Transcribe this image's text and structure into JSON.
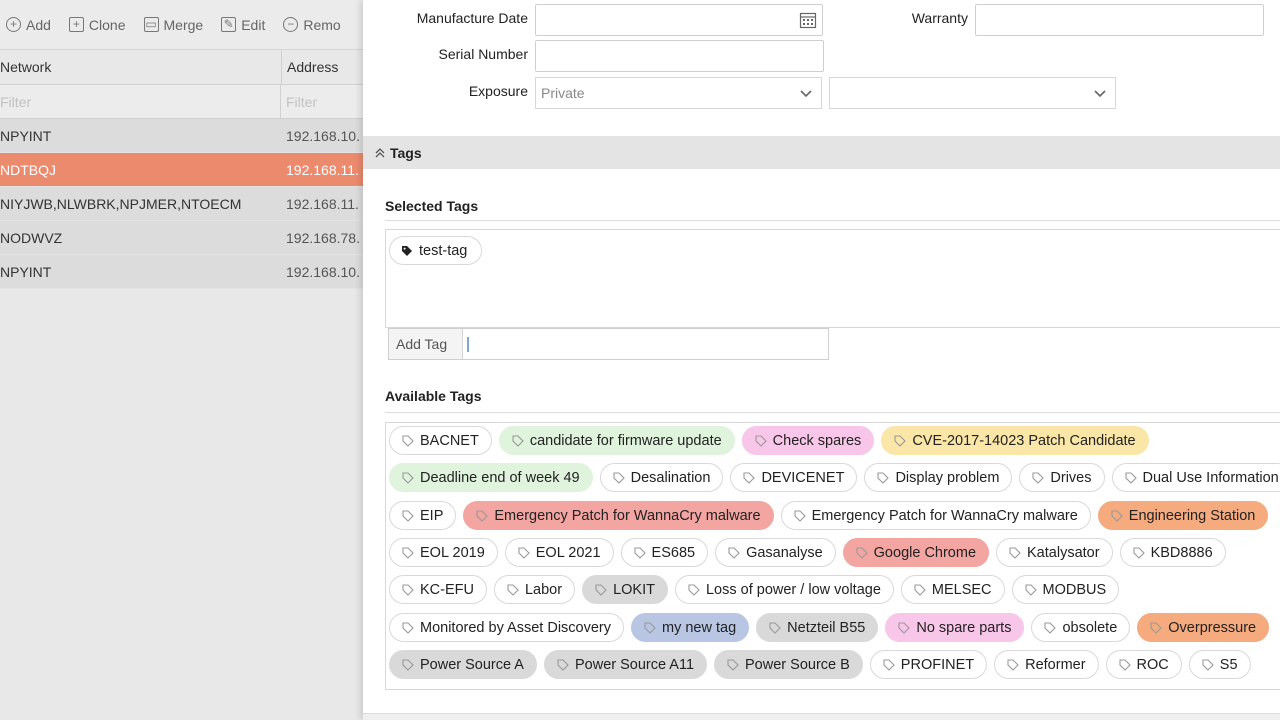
{
  "toolbar": {
    "add": "Add",
    "clone": "Clone",
    "merge": "Merge",
    "edit": "Edit",
    "remove": "Remo"
  },
  "grid": {
    "col_network": "Network",
    "col_address": "Address",
    "filter_placeholder": "Filter",
    "rows": [
      {
        "network": "NPYINT",
        "address": "192.168.10.",
        "selected": false
      },
      {
        "network": "NDTBQJ",
        "address": "192.168.11.",
        "selected": true
      },
      {
        "network": "NIYJWB,NLWBRK,NPJMER,NTOECM",
        "address": "192.168.11.",
        "selected": false
      },
      {
        "network": "NODWVZ",
        "address": "192.168.78.",
        "selected": false
      },
      {
        "network": "NPYINT",
        "address": "192.168.10.",
        "selected": false
      }
    ]
  },
  "form": {
    "manufacture_date_label": "Manufacture Date",
    "warranty_label": "Warranty",
    "serial_number_label": "Serial Number",
    "exposure_label": "Exposure",
    "exposure_value": "Private",
    "exposure_second_value": ""
  },
  "tags_section": {
    "title": "Tags",
    "selected_title": "Selected Tags",
    "selected_tags": [
      "test-tag"
    ],
    "add_tag_label": "Add Tag",
    "available_title": "Available Tags",
    "rows": [
      [
        {
          "label": "BACNET",
          "color": "white"
        },
        {
          "label": "candidate for firmware update",
          "color": "green"
        },
        {
          "label": "Check spares",
          "color": "pink"
        },
        {
          "label": "CVE-2017-14023 Patch Candidate",
          "color": "yellow"
        }
      ],
      [
        {
          "label": "Deadline end of week 49",
          "color": "green"
        },
        {
          "label": "Desalination",
          "color": "white"
        },
        {
          "label": "DEVICENET",
          "color": "white"
        },
        {
          "label": "Display problem",
          "color": "white"
        },
        {
          "label": "Drives",
          "color": "white"
        },
        {
          "label": "Dual Use Information",
          "color": "white"
        }
      ],
      [
        {
          "label": "EIP",
          "color": "white"
        },
        {
          "label": "Emergency Patch for WannaCry malware",
          "color": "red"
        },
        {
          "label": "Emergency Patch for WannaCry malware",
          "color": "white"
        },
        {
          "label": "Engineering Station",
          "color": "orange"
        }
      ],
      [
        {
          "label": "EOL 2019",
          "color": "white"
        },
        {
          "label": "EOL 2021",
          "color": "white"
        },
        {
          "label": "ES685",
          "color": "white"
        },
        {
          "label": "Gasanalyse",
          "color": "white"
        },
        {
          "label": "Google Chrome",
          "color": "red"
        },
        {
          "label": "Katalysator",
          "color": "white"
        },
        {
          "label": "KBD8886",
          "color": "white"
        }
      ],
      [
        {
          "label": "KC-EFU",
          "color": "white"
        },
        {
          "label": "Labor",
          "color": "white"
        },
        {
          "label": "LOKIT",
          "color": "grey"
        },
        {
          "label": "Loss of power / low voltage",
          "color": "white"
        },
        {
          "label": "MELSEC",
          "color": "white"
        },
        {
          "label": "MODBUS",
          "color": "white"
        }
      ],
      [
        {
          "label": "Monitored by Asset Discovery",
          "color": "white"
        },
        {
          "label": "my new tag",
          "color": "blue"
        },
        {
          "label": "Netzteil B55",
          "color": "grey"
        },
        {
          "label": "No spare parts",
          "color": "pink"
        },
        {
          "label": "obsolete",
          "color": "white"
        },
        {
          "label": "Overpressure",
          "color": "orange"
        }
      ],
      [
        {
          "label": "Power Source A",
          "color": "grey"
        },
        {
          "label": "Power Source A11",
          "color": "grey"
        },
        {
          "label": "Power Source B",
          "color": "grey"
        },
        {
          "label": "PROFINET",
          "color": "white"
        },
        {
          "label": "Reformer",
          "color": "white"
        },
        {
          "label": "ROC",
          "color": "white"
        },
        {
          "label": "S5",
          "color": "white"
        }
      ]
    ]
  }
}
